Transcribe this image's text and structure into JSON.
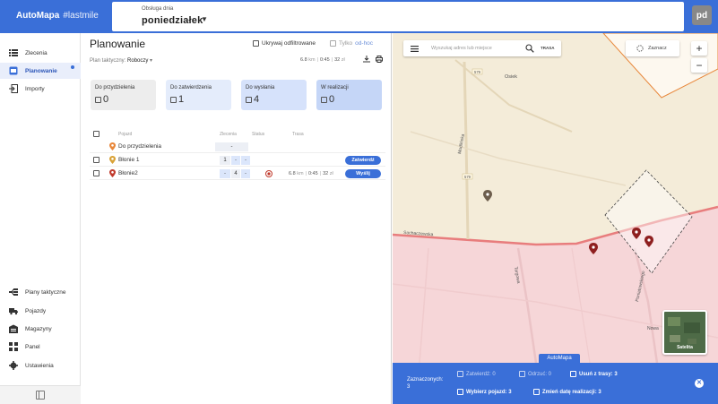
{
  "header": {
    "logo": "AutoMapa",
    "logo_tag": "#lastmile",
    "day_label": "Obsługa dnia",
    "day_value": "poniedziałek",
    "avatar": "pd"
  },
  "sidebar": {
    "top_items": [
      {
        "label": "Zlecenia",
        "icon": "list-icon"
      },
      {
        "label": "Planowanie",
        "icon": "planning-icon",
        "active": true
      },
      {
        "label": "Importy",
        "icon": "import-icon"
      }
    ],
    "bottom_items": [
      {
        "label": "Plany taktyczne",
        "icon": "tactical-plans-icon"
      },
      {
        "label": "Pojazdy",
        "icon": "truck-icon"
      },
      {
        "label": "Magazyny",
        "icon": "warehouse-icon"
      },
      {
        "label": "Panel",
        "icon": "dashboard-icon"
      },
      {
        "label": "Ustawienia",
        "icon": "gear-icon"
      }
    ]
  },
  "planning": {
    "title": "Planowanie",
    "hide_filtered_label": "Ukrywaj odfiltrowane",
    "only_label": "Tylko",
    "only_link": "od-hoc",
    "plan_label": "Plan taktyczny:",
    "plan_value": "Roboczy",
    "stats": {
      "km": "6.8",
      "km_unit": "km",
      "time": "0:45",
      "cost": "32",
      "cost_unit": "zł"
    },
    "cards": [
      {
        "label": "Do przydzielenia",
        "value": "0",
        "color": "#ededed"
      },
      {
        "label": "Do zatwierdzenia",
        "value": "1",
        "color": "#e4ecfb"
      },
      {
        "label": "Do wysłania",
        "value": "4",
        "color": "#d6e2fb"
      },
      {
        "label": "W realizacji",
        "value": "0",
        "color": "#c5d6f7"
      }
    ],
    "table": {
      "headers": {
        "vehicle": "Pojazd",
        "orders": "Zlecenia",
        "status": "Status",
        "route": "Trasa"
      },
      "rows": [
        {
          "name": "Do przydzielenia",
          "orders": [
            "-"
          ]
        },
        {
          "name": "Błonie 1",
          "orders": [
            "1",
            "-",
            "-"
          ],
          "action": "Zatwierdź"
        },
        {
          "name": "Błonie2",
          "orders": [
            "-",
            "4",
            "-"
          ],
          "route": {
            "km": "6.8",
            "km_unit": "km",
            "time": "0:45",
            "cost": "32",
            "cost_unit": "zł"
          },
          "action": "Wyślij"
        }
      ]
    }
  },
  "map": {
    "search_placeholder": "Wyszukaj adres lub miejsce",
    "route_label": "TRASA",
    "select_label": "Zaznacz",
    "zoom_in": "+",
    "zoom_out": "−",
    "satellite_label": "Satelita",
    "brand": "AutoMapa",
    "labels": {
      "osiek": "Osiek",
      "modlinska": "Modlińska",
      "sochaczewska": "Sochaczewska",
      "targowa": "Targowa",
      "poniatowskiego": "Poniatowskiego",
      "nowa": "Nowa",
      "road579a": "579",
      "road579b": "579"
    }
  },
  "selection": {
    "title": "Zaznaczonych:",
    "count": "3",
    "approve": "Zatwierdź: 0",
    "reject": "Odrzuć: 0",
    "remove": "Usuń z trasy: 3",
    "vehicle": "Wybierz pojazd: 3",
    "date": "Zmień datę realizacji: 3"
  }
}
